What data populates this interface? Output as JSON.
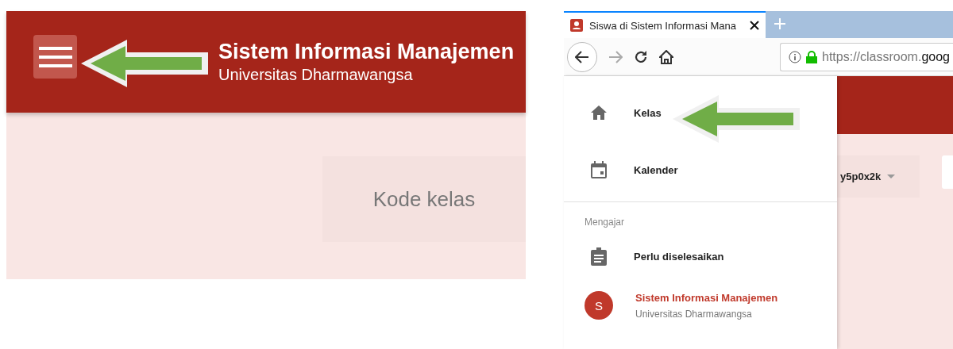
{
  "left_screen": {
    "header": {
      "title": "Sistem Informasi Manajemen",
      "subtitle": "Universitas Dharmawangsa"
    },
    "class_code_label": "Kode kelas"
  },
  "right_screen": {
    "browser": {
      "tab_title": "Siswa di Sistem Informasi Mana",
      "url": {
        "scheme_part": "https://classroom.",
        "host_part": "goog"
      }
    },
    "drawer": {
      "items": [
        {
          "label": "Kelas"
        },
        {
          "label": "Kalender"
        }
      ],
      "section": {
        "heading": "Mengajar",
        "items": [
          {
            "label": "Perlu diselesaikan"
          }
        ]
      },
      "classes": [
        {
          "name": "Sistem Informasi Manajemen",
          "subtitle": "Universitas Dharmawangsa",
          "avatar": "S",
          "color": "#c0392b"
        }
      ]
    },
    "class_code": "y5p0x2k"
  }
}
